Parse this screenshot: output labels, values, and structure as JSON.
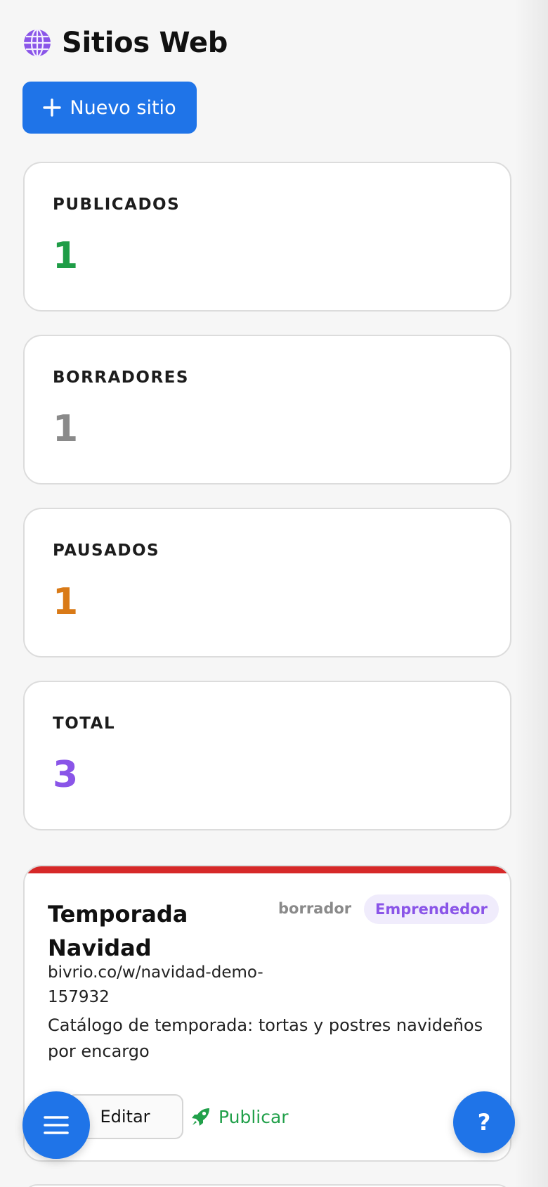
{
  "header": {
    "title": "Sitios Web",
    "icon": "globe-icon"
  },
  "actions": {
    "new_site_label": "Nuevo sitio"
  },
  "stats": [
    {
      "label": "PUBLICADOS",
      "value": "1",
      "color": "#1f9d47"
    },
    {
      "label": "BORRADORES",
      "value": "1",
      "color": "#8a8a8a"
    },
    {
      "label": "PAUSADOS",
      "value": "1",
      "color": "#d97a17"
    },
    {
      "label": "TOTAL",
      "value": "3",
      "color": "#8a55e8"
    }
  ],
  "sites": [
    {
      "title": "Temporada Navidad",
      "status": "borrador",
      "plan": "Emprendedor",
      "url": "bivrio.co/w/navidad-demo-157932",
      "description": "Catálogo de temporada: tortas y postres navideños por encargo",
      "edit_label": "Editar",
      "publish_label": "Publicar",
      "accent_color": "#d62828"
    }
  ],
  "fab": {
    "menu_icon": "hamburger-menu-icon",
    "help_label": "?"
  },
  "colors": {
    "primary": "#1f74e8",
    "publish": "#21a04a",
    "plan_badge_text": "#8a55e8",
    "plan_badge_bg": "#f0ecfc"
  }
}
